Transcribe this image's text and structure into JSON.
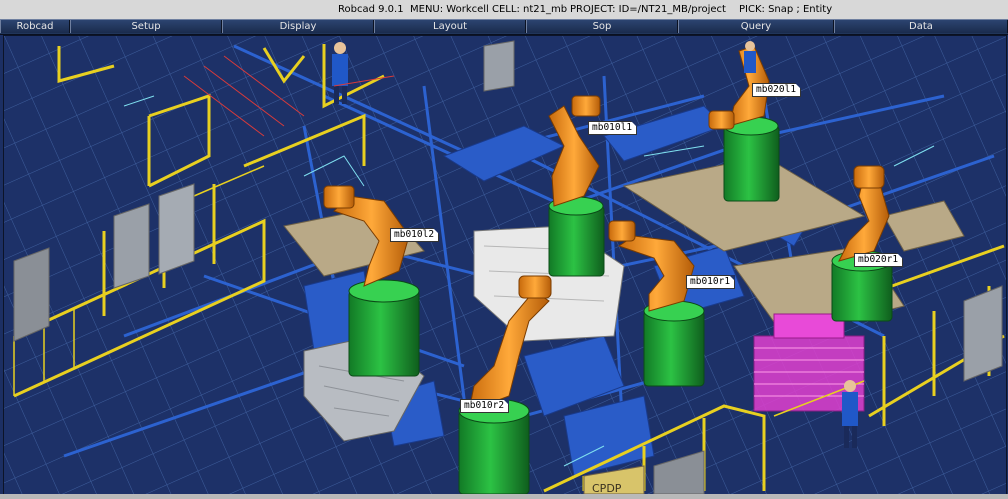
{
  "status_bar": {
    "app_version": "Robcad 9.0.1",
    "menu": "MENU: Workcell",
    "cell": "CELL: nt21_mb",
    "project": "PROJECT: ID=/NT21_MB/project",
    "pick": "PICK: Snap ; Entity"
  },
  "menu_bar": {
    "items": [
      "Robcad",
      "Setup",
      "Display",
      "Layout",
      "Sop",
      "Query",
      "Data"
    ]
  },
  "viewport": {
    "robot_labels": [
      "mb010l1",
      "mb020l1",
      "mb010l2",
      "mb010r1",
      "mb020r1",
      "mb010r2"
    ],
    "sign_text": "CPDP"
  },
  "colors": {
    "background": "#1d3168",
    "grid": "#4a6aa8",
    "robot": "#f0961e",
    "pedestal": "#23a83a",
    "fence": "#e8d020",
    "fixture": "#2c62d0",
    "fixture_magenta": "#e040d0",
    "menu_bar": "#20355a",
    "title_bar": "#d8d8d8"
  },
  "icons": [
    "robot-arm-icon",
    "operator-figure-icon",
    "car-body-icon",
    "fixture-rack-icon"
  ]
}
